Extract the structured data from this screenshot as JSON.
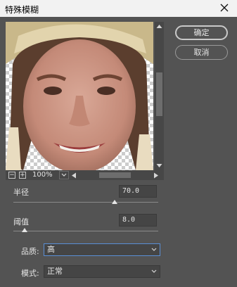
{
  "dialog": {
    "title": "特殊模糊",
    "ok_label": "确定",
    "cancel_label": "取消"
  },
  "preview": {
    "zoom_label": "100%",
    "minus_icon": "zoom-out-icon",
    "plus_icon": "zoom-in-icon"
  },
  "radius": {
    "label": "半径",
    "value": "70.0",
    "slider_level": 0.7
  },
  "threshold": {
    "label": "阈值",
    "value": "8.0",
    "slider_level": 0.08
  },
  "quality": {
    "label": "品质:",
    "selected": "高"
  },
  "mode": {
    "label": "模式:",
    "selected": "正常"
  },
  "colors": {
    "background": "#535353",
    "titlebar": "#f2f2f2",
    "focus": "#5a8fd6"
  }
}
